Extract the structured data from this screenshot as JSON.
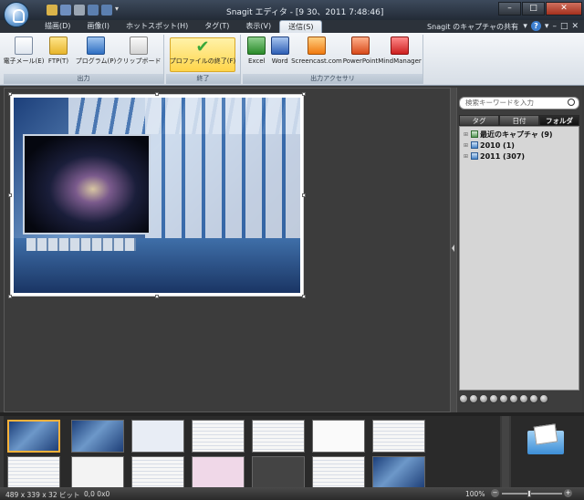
{
  "window": {
    "title": "Snagit エディタ - [9 30、2011 7:48:46]",
    "minimize_label": "–",
    "maximize_label": "□",
    "close_label": "✕"
  },
  "tabs": [
    {
      "label": "描画(D)"
    },
    {
      "label": "画像(I)"
    },
    {
      "label": "ホットスポット(H)"
    },
    {
      "label": "タグ(T)"
    },
    {
      "label": "表示(V)"
    },
    {
      "label": "送信(S)"
    }
  ],
  "share_label": "Snagit のキャプチャの共有",
  "ribbon": {
    "output": {
      "name": "出力",
      "buttons": [
        {
          "label": "電子メール(E)",
          "icon": "email-icon"
        },
        {
          "label": "FTP(T)",
          "icon": "ftp-icon"
        },
        {
          "label": "プログラム(P)",
          "icon": "program-icon"
        },
        {
          "label": "クリップボード",
          "icon": "clipboard-icon"
        }
      ]
    },
    "finish": {
      "name": "終了",
      "button": "プロファイルの終了(F)"
    },
    "accessories": {
      "name": "出力アクセサリ",
      "buttons": [
        {
          "label": "Excel",
          "icon": "excel-icon"
        },
        {
          "label": "Word",
          "icon": "word-icon"
        },
        {
          "label": "Screencast.com",
          "icon": "screencast-icon"
        },
        {
          "label": "PowerPoint",
          "icon": "powerpoint-icon"
        },
        {
          "label": "MindManager",
          "icon": "mindmanager-icon"
        }
      ]
    }
  },
  "library": {
    "search_placeholder": "検索キーワードを入力",
    "tabs": [
      {
        "label": "タグ"
      },
      {
        "label": "日付"
      },
      {
        "label": "フォルダ"
      }
    ],
    "tree": [
      {
        "label": "最近のキャプチャ (9)"
      },
      {
        "label": "2010 (1)"
      },
      {
        "label": "2011 (307)"
      }
    ]
  },
  "status": {
    "image_info": "489 x 339 x 32 ビット",
    "coords": "0,0   0x0",
    "zoom": "100%"
  }
}
